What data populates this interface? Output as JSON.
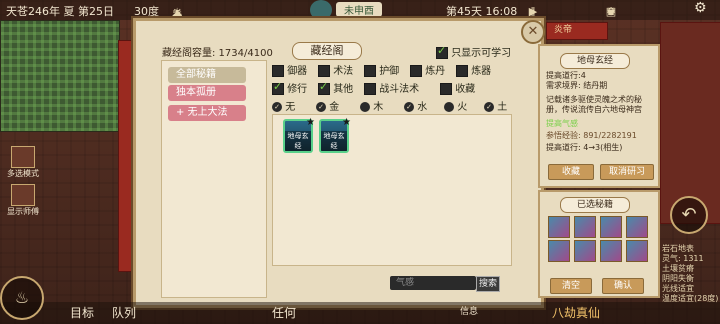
{
  "status_bar": {
    "date": "天苍246年 夏 第25日",
    "temperature": "30度",
    "location_tag": "未申酉",
    "day_time": "第45天 16:08"
  },
  "top_right": {
    "badge_label": "炎帝"
  },
  "left_side": {
    "multi_select_label": "多选模式",
    "display_mode_label": "显示师傅"
  },
  "panel": {
    "title": "藏经阁",
    "capacity_label": "藏经阁容量: 1734/4100",
    "only_learnable_label": "只显示可学习",
    "only_learnable_checked": true,
    "categories": [
      {
        "label": "全部秘籍",
        "style": "active"
      },
      {
        "label": "独本孤册",
        "style": "pink"
      },
      {
        "label": "+ 无上大法",
        "style": "pink"
      }
    ],
    "filter_row1": [
      {
        "label": "御器",
        "checked": false
      },
      {
        "label": "术法",
        "checked": false
      },
      {
        "label": "护御",
        "checked": false
      },
      {
        "label": "炼丹",
        "checked": false
      },
      {
        "label": "炼器",
        "checked": false
      }
    ],
    "filter_row2": [
      {
        "label": "修行",
        "checked": true
      },
      {
        "label": "其他",
        "checked": true
      },
      {
        "label": "战斗法术",
        "checked": false
      },
      {
        "label": "收藏",
        "checked": false
      }
    ],
    "element_row": [
      {
        "label": "无",
        "checked": true
      },
      {
        "label": "金",
        "checked": true
      },
      {
        "label": "木",
        "checked": false
      },
      {
        "label": "水",
        "checked": true
      },
      {
        "label": "火",
        "checked": false
      },
      {
        "label": "土",
        "checked": true
      }
    ],
    "skills": [
      {
        "label": "地母玄经"
      },
      {
        "label": "地母玄经"
      }
    ],
    "search_placeholder": "气感",
    "search_button": "搜索"
  },
  "detail": {
    "title": "地母玄经",
    "lines": [
      "提高道行:4",
      "需求境界: 结丹期",
      "",
      "记载诸多驱使灵魄之术的秘",
      "册，传说流传自六地母神宫",
      "",
      "提高气感",
      "参悟经验: 891/2282191",
      "提高道行: 4→3(相生)"
    ],
    "collect_button": "收藏",
    "cancel_button": "取消研习"
  },
  "selected": {
    "title": "已选秘籍",
    "clear_button": "清空",
    "confirm_button": "确认"
  },
  "right_stats": {
    "lines": [
      "岩石地表",
      "灵气: 1311",
      "土壤贫瘠",
      "阴阳失衡",
      "光线适宜",
      "温度适宜(28度)"
    ]
  },
  "bottom_bar": {
    "target_label": "目标",
    "team_label": "队列",
    "any_label": "任何",
    "info_label": "信息",
    "realm_label": "八劫真仙"
  },
  "colors": {
    "panel_bg": "#e8dcc0",
    "border": "#b89a6a",
    "pink_tab": "#d8808a",
    "check_green": "#7ad04a"
  }
}
